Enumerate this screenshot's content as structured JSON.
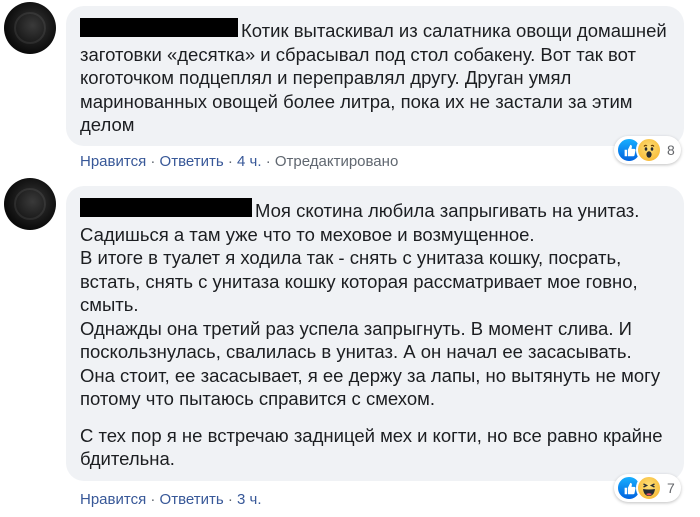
{
  "comments": [
    {
      "paragraphs": [
        "Котик вытаскивал из салатника овощи домашней заготовки «десятка» и сбрасывал под стол собакену. Вот так вот коготочком подцеплял и переправлял другу. Друган умял маринованных овощей более литра, пока их не застали за этим делом"
      ],
      "actions": {
        "like": "Нравится",
        "reply": "Ответить",
        "time": "4 ч.",
        "edited": "Отредактировано"
      },
      "reactions": {
        "icons": [
          "like-icon",
          "wow-icon"
        ],
        "count": "8"
      }
    },
    {
      "paragraphs": [
        "Моя скотина любила запрыгивать на унитаз. Садишься а там уже что то меховое и возмущенное.",
        "В итоге в туалет я ходила так - снять с унитаза кошку, посрать, встать, снять с унитаза кошку которая рассматривает мое говно, смыть.",
        "Однажды она третий раз успела запрыгнуть. В момент слива. И поскользнулась, свалилась в унитаз. А он начал ее засасывать. Она стоит, ее засасывает, я ее держу за лапы, но вытянуть не могу потому что пытаюсь справится с смехом.",
        "С тех пор я не встречаю задницей мех и когти, но все равно крайне бдительна."
      ],
      "actions": {
        "like": "Нравится",
        "reply": "Ответить",
        "time": "3 ч."
      },
      "reactions": {
        "icons": [
          "like-icon",
          "haha-icon"
        ],
        "count": "7"
      }
    }
  ],
  "separator": "·",
  "colors": {
    "bubble": "#f0f2f5",
    "link": "#385898",
    "meta": "#606770",
    "text": "#1c1e21"
  }
}
